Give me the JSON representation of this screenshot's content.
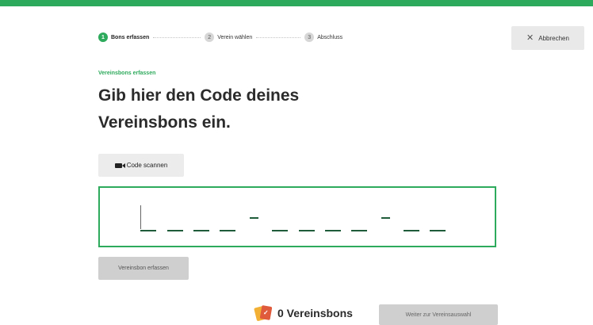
{
  "stepper": {
    "steps": [
      {
        "number": "1",
        "label": "Bons erfassen",
        "active": true
      },
      {
        "number": "2",
        "label": "Verein wählen",
        "active": false
      },
      {
        "number": "3",
        "label": "Abschluss",
        "active": false
      }
    ]
  },
  "header": {
    "cancel_label": "Abbrechen",
    "cancel_icon": "close-icon"
  },
  "main": {
    "overline": "Vereinsbons erfassen",
    "title": "Gib hier den Code deines Vereinsbons ein.",
    "scan_label": "Code scannen",
    "scan_icon": "camera-icon",
    "code_format": "____-____-__",
    "record_label": "Vereinsbon erfassen"
  },
  "footer": {
    "count_label": "0 Vereinsbons",
    "count_icon": "vouchers-icon",
    "next_label": "Weiter zur Vereinsauswahl"
  },
  "colors": {
    "accent": "#2eaa5c",
    "code_dashes": "#1e5c3a",
    "disabled_button": "#cfcfcf"
  }
}
